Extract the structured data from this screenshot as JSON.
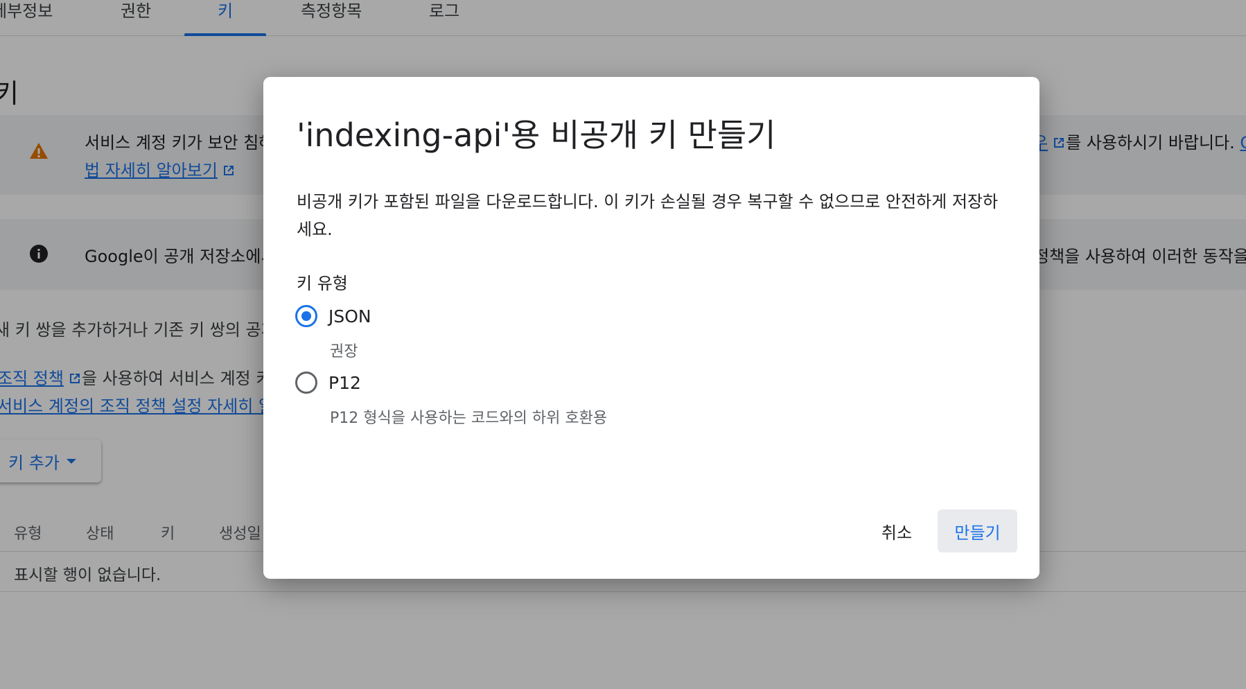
{
  "tabs": [
    {
      "label": "세부정보"
    },
    {
      "label": "권한"
    },
    {
      "label": "키"
    },
    {
      "label": "측정항목"
    },
    {
      "label": "로그"
    }
  ],
  "background": {
    "section_title": "키",
    "warning": {
      "line1_start": "서비스 계정 키가 보안 침해",
      "line1_end_link": "우",
      "line1_end": "를 사용하시기 바랍니다.",
      "line1_tail": "C",
      "line2_link": "법 자세히 알아보기"
    },
    "info": {
      "text_start": "Google이 공개 저장소에서",
      "text_end": "정책을 사용하여 이러한 동작을"
    },
    "para1": "새 키 쌍을 추가하거나 기존 키 쌍의 공개",
    "para2_link": "조직 정책",
    "para2_rest": "을 사용하여 서비스 계정 키",
    "para3_link": "서비스 계정의 조직 정책 설정 자세히 알",
    "add_key_button": "키 추가",
    "table_headers": [
      "유형",
      "상태",
      "키",
      "생성일"
    ],
    "empty_text": "표시할 행이 없습니다."
  },
  "dialog": {
    "title": "'indexing-api'용 비공개 키 만들기",
    "description": "비공개 키가 포함된 파일을 다운로드합니다. 이 키가 손실될 경우 복구할 수 없으므로 안전하게 저장하세요.",
    "key_type_label": "키 유형",
    "options": [
      {
        "label": "JSON",
        "sublabel": "권장",
        "checked": true
      },
      {
        "label": "P12",
        "sublabel": "P12 형식을 사용하는 코드와의 하위 호환용",
        "checked": false
      }
    ],
    "cancel_label": "취소",
    "create_label": "만들기"
  },
  "colors": {
    "accent": "#1a73e8",
    "warning_icon": "#e37400",
    "scrim": "rgba(0,0,0,0.34)"
  }
}
